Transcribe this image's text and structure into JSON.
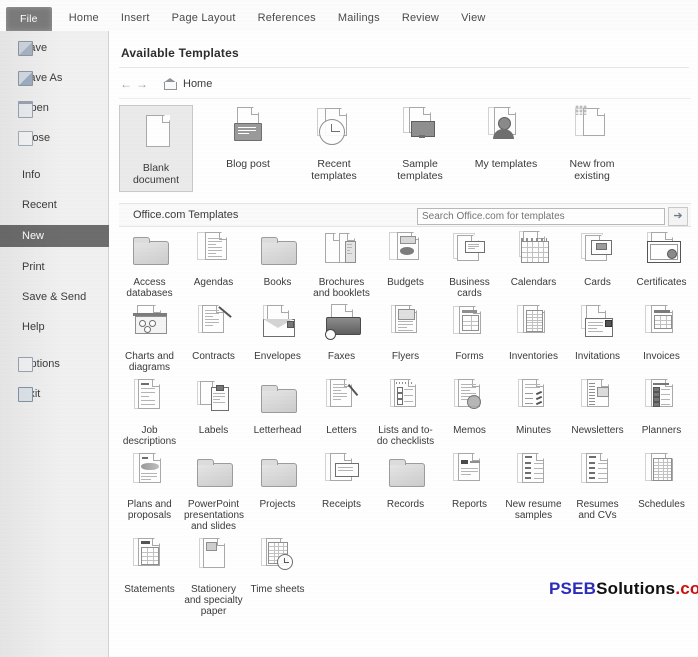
{
  "window": {
    "app": "Microsoft Word 2010 Backstage",
    "ribbon_tabs": [
      {
        "label": "File",
        "active": true
      },
      {
        "label": "Home",
        "active": false
      },
      {
        "label": "Insert",
        "active": false
      },
      {
        "label": "Page Layout",
        "active": false
      },
      {
        "label": "References",
        "active": false
      },
      {
        "label": "Mailings",
        "active": false
      },
      {
        "label": "Review",
        "active": false
      },
      {
        "label": "View",
        "active": false
      }
    ]
  },
  "backstage": {
    "items": [
      {
        "label": "Save",
        "icon": "save-icon",
        "has_icon": true,
        "selected": false
      },
      {
        "label": "Save As",
        "icon": "save-as-icon",
        "has_icon": true,
        "selected": false
      },
      {
        "label": "Open",
        "icon": "open-folder-icon",
        "has_icon": true,
        "selected": false
      },
      {
        "label": "Close",
        "icon": "close-document-icon",
        "has_icon": true,
        "selected": false
      },
      {
        "label": "Info",
        "icon": "",
        "has_icon": false,
        "selected": false
      },
      {
        "label": "Recent",
        "icon": "",
        "has_icon": false,
        "selected": false
      },
      {
        "label": "New",
        "icon": "",
        "has_icon": false,
        "selected": true
      },
      {
        "label": "Print",
        "icon": "",
        "has_icon": false,
        "selected": false
      },
      {
        "label": "Save & Send",
        "icon": "",
        "has_icon": false,
        "selected": false
      },
      {
        "label": "Help",
        "icon": "",
        "has_icon": false,
        "selected": false
      },
      {
        "label": "Options",
        "icon": "options-icon",
        "has_icon": true,
        "selected": false
      },
      {
        "label": "Exit",
        "icon": "exit-icon",
        "has_icon": true,
        "selected": false
      }
    ]
  },
  "main": {
    "page_title": "Available Templates",
    "breadcrumb": {
      "back_label": "←",
      "forward_label": "→",
      "home_label": "Home"
    },
    "top_templates": [
      {
        "label": "Blank document",
        "icon": "blank-document-icon",
        "selected": true
      },
      {
        "label": "Blog post",
        "icon": "blog-post-icon",
        "selected": false
      },
      {
        "label": "Recent templates",
        "icon": "recent-templates-icon",
        "selected": false
      },
      {
        "label": "Sample templates",
        "icon": "sample-templates-icon",
        "selected": false
      },
      {
        "label": "My templates",
        "icon": "my-templates-icon",
        "selected": false
      },
      {
        "label": "New from existing",
        "icon": "new-from-existing-icon",
        "selected": false
      }
    ],
    "office_band": {
      "label": "Office.com Templates",
      "search_placeholder": "Search Office.com for templates",
      "search_value": "",
      "go_label": "➔"
    },
    "categories": [
      {
        "label": "Access databases",
        "icon": "folder-icon"
      },
      {
        "label": "Agendas",
        "icon": "document-stack-icon"
      },
      {
        "label": "Books",
        "icon": "folder-icon"
      },
      {
        "label": "Brochures and booklets",
        "icon": "brochure-icon"
      },
      {
        "label": "Budgets",
        "icon": "budget-chart-icon"
      },
      {
        "label": "Business cards",
        "icon": "business-card-icon"
      },
      {
        "label": "Calendars",
        "icon": "calendar-icon"
      },
      {
        "label": "Cards",
        "icon": "card-icon"
      },
      {
        "label": "Certificates",
        "icon": "certificate-icon"
      },
      {
        "label": "Charts and diagrams",
        "icon": "chart-diagram-icon"
      },
      {
        "label": "Contracts",
        "icon": "contract-pen-icon"
      },
      {
        "label": "Envelopes",
        "icon": "envelope-icon"
      },
      {
        "label": "Faxes",
        "icon": "fax-machine-icon"
      },
      {
        "label": "Flyers",
        "icon": "flyer-icon"
      },
      {
        "label": "Forms",
        "icon": "form-icon"
      },
      {
        "label": "Inventories",
        "icon": "inventory-table-icon"
      },
      {
        "label": "Invitations",
        "icon": "invitation-icon"
      },
      {
        "label": "Invoices",
        "icon": "invoice-icon"
      },
      {
        "label": "Job descriptions",
        "icon": "job-description-icon"
      },
      {
        "label": "Labels",
        "icon": "label-icon"
      },
      {
        "label": "Letterhead",
        "icon": "folder-icon"
      },
      {
        "label": "Letters",
        "icon": "letter-pen-icon"
      },
      {
        "label": "Lists and to-do checklists",
        "icon": "checklist-icon"
      },
      {
        "label": "Memos",
        "icon": "memo-pin-icon"
      },
      {
        "label": "Minutes",
        "icon": "minutes-icon"
      },
      {
        "label": "Newsletters",
        "icon": "newsletter-icon"
      },
      {
        "label": "Planners",
        "icon": "planner-icon"
      },
      {
        "label": "Plans and proposals",
        "icon": "plan-proposal-icon"
      },
      {
        "label": "PowerPoint presentations and slides",
        "icon": "folder-icon"
      },
      {
        "label": "Projects",
        "icon": "folder-icon"
      },
      {
        "label": "Receipts",
        "icon": "receipt-icon"
      },
      {
        "label": "Records",
        "icon": "folder-icon"
      },
      {
        "label": "Reports",
        "icon": "report-icon"
      },
      {
        "label": "New resume samples",
        "icon": "resume-icon"
      },
      {
        "label": "Resumes and CVs",
        "icon": "resume-icon"
      },
      {
        "label": "Schedules",
        "icon": "schedule-table-icon"
      },
      {
        "label": "Statements",
        "icon": "statement-icon"
      },
      {
        "label": "Stationery and specialty paper",
        "icon": "stationery-icon"
      },
      {
        "label": "Time sheets",
        "icon": "time-sheet-icon"
      }
    ]
  },
  "watermark": {
    "part1": "PSEB",
    "part2": "Solutions",
    "part3": ".com",
    "color1": "#2b2bbd",
    "color2": "#111111",
    "color3": "#cc1111"
  }
}
